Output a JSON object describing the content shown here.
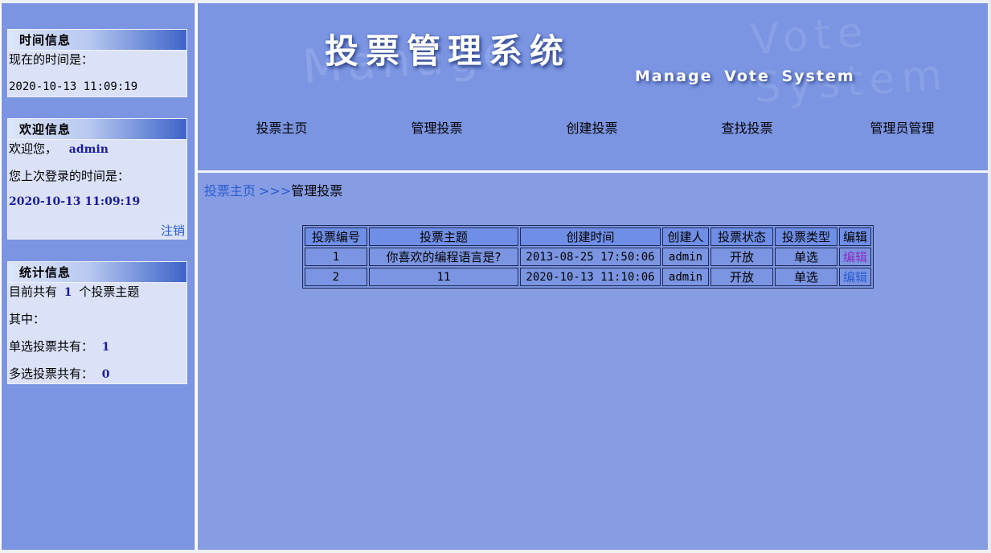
{
  "sidebar": {
    "time_panel": {
      "title": "时间信息",
      "label": "现在的时间是：",
      "current_time": "2020-10-13 11:09:19"
    },
    "welcome_panel": {
      "title": "欢迎信息",
      "greeting": "欢迎您，",
      "username": "admin",
      "last_login_label": "您上次登录的时间是：",
      "last_login_time": "2020-10-13 11:09:19",
      "logout": "注销"
    },
    "stats_panel": {
      "title": "统计信息",
      "total_prefix": "目前共有",
      "total_count": "1",
      "total_suffix": "个投票主题",
      "among": "其中：",
      "single_label": "单选投票共有：",
      "single_count": "1",
      "multi_label": "多选投票共有：",
      "multi_count": "0"
    }
  },
  "header": {
    "title": "投票管理系统",
    "subtitle": "Manage  Vote  System",
    "watermark_left": "Manage",
    "watermark_right": "Vote  System"
  },
  "nav": {
    "items": [
      {
        "label": "投票主页"
      },
      {
        "label": "管理投票"
      },
      {
        "label": "创建投票"
      },
      {
        "label": "查找投票"
      },
      {
        "label": "管理员管理"
      }
    ]
  },
  "breadcrumb": {
    "home": "投票主页",
    "separator": ">>>",
    "current": "管理投票"
  },
  "table": {
    "headers": [
      "投票编号",
      "投票主题",
      "创建时间",
      "创建人",
      "投票状态",
      "投票类型",
      "编辑"
    ],
    "rows": [
      {
        "id": "1",
        "subject": "你喜欢的编程语言是?",
        "created": "2013-08-25 17:50:06",
        "creator": "admin",
        "status": "开放",
        "type": "单选",
        "edit": "编辑",
        "edit_color": "#8a2dbf"
      },
      {
        "id": "2",
        "subject": "11",
        "created": "2020-10-13 11:10:06",
        "creator": "admin",
        "status": "开放",
        "type": "单选",
        "edit": "编辑",
        "edit_color": "#2a5bd0"
      }
    ]
  },
  "colors": {
    "background": "#7b95e2",
    "content": "#869de3",
    "panel_body": "#dbe2f8",
    "link": "#2a5bd0",
    "visited_link": "#8a2dbf"
  }
}
